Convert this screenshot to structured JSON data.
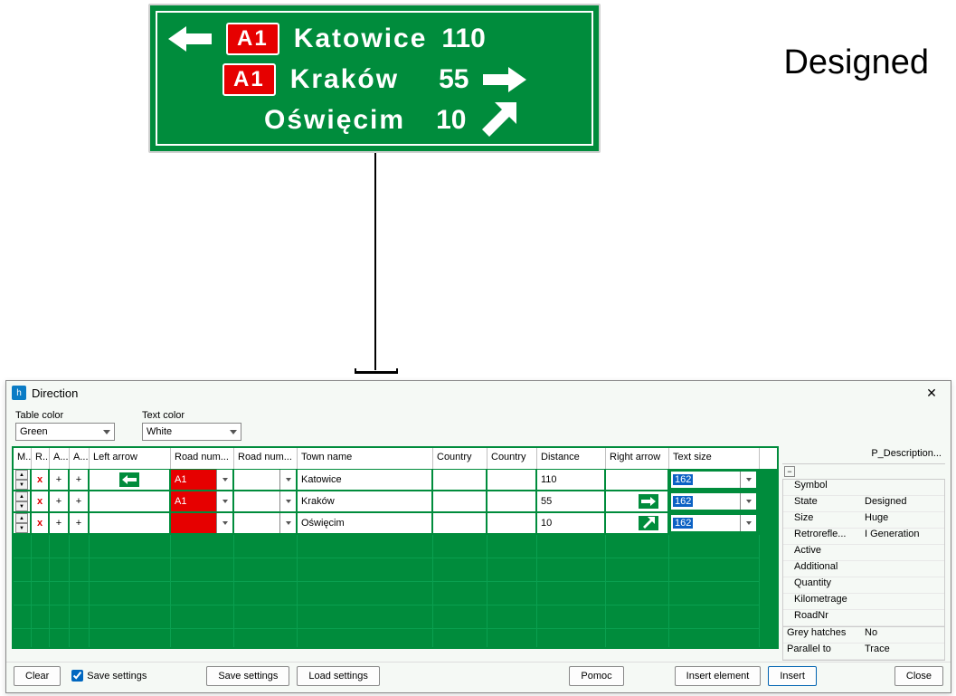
{
  "status_label": "Designed",
  "sign": {
    "rows": [
      {
        "shield": "A1",
        "town": "Katowice",
        "dist": "110"
      },
      {
        "shield": "A1",
        "town": "Kraków",
        "dist": "55"
      },
      {
        "shield": "",
        "town": "Oświęcim",
        "dist": "10"
      }
    ]
  },
  "dialog": {
    "title": "Direction",
    "labels": {
      "table_color": "Table color",
      "text_color": "Text color"
    },
    "table_color": "Green",
    "text_color": "White",
    "grid": {
      "headers": [
        "M..",
        "R...",
        "A...",
        "A...",
        "Left arrow",
        "Road num...",
        "Road num...",
        "Town name",
        "Country",
        "Country",
        "Distance",
        "Right arrow",
        "Text size"
      ],
      "rows": [
        {
          "x": "x",
          "p1": "+",
          "p2": "+",
          "left_arrow": true,
          "road1": "A1",
          "road2": "",
          "town": "Katowice",
          "country1": "",
          "country2": "",
          "dist": "110",
          "right_arrow": "",
          "tsize": "162"
        },
        {
          "x": "x",
          "p1": "+",
          "p2": "+",
          "left_arrow": false,
          "road1": "A1",
          "road2": "",
          "town": "Kraków",
          "country1": "",
          "country2": "",
          "dist": "55",
          "right_arrow": "right",
          "tsize": "162"
        },
        {
          "x": "x",
          "p1": "+",
          "p2": "+",
          "left_arrow": false,
          "road1": "",
          "road2": "",
          "town": "Oświęcim",
          "country1": "",
          "country2": "",
          "dist": "10",
          "right_arrow": "upright",
          "tsize": "162"
        }
      ]
    },
    "properties": {
      "header": "P_Description...",
      "items": [
        {
          "k": "Symbol",
          "v": ""
        },
        {
          "k": "State",
          "v": "Designed"
        },
        {
          "k": "Size",
          "v": "Huge"
        },
        {
          "k": "Retrorefle...",
          "v": "I Generation"
        },
        {
          "k": "Active",
          "v": ""
        },
        {
          "k": "Additional",
          "v": ""
        },
        {
          "k": "Quantity",
          "v": ""
        },
        {
          "k": "Kilometrage",
          "v": ""
        },
        {
          "k": "RoadNr",
          "v": ""
        }
      ],
      "extra": [
        {
          "k": "Grey hatches",
          "v": "No"
        },
        {
          "k": "Parallel to",
          "v": "Trace"
        }
      ]
    },
    "footer": {
      "clear": "Clear",
      "save_cb": "Save settings",
      "save": "Save settings",
      "load": "Load settings",
      "help": "Pomoc",
      "ins_el": "Insert element",
      "insert": "Insert",
      "close": "Close"
    }
  }
}
